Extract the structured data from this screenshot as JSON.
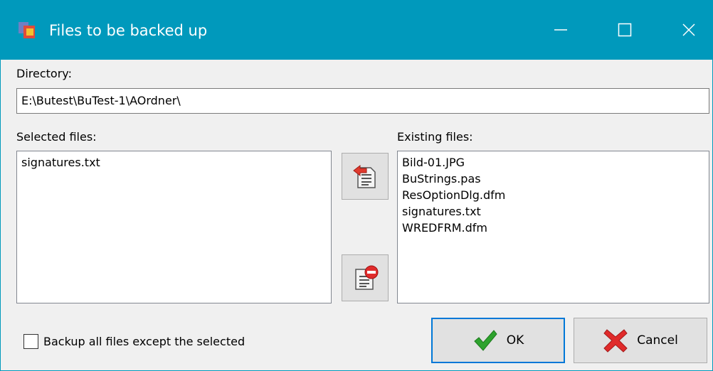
{
  "window": {
    "title": "Files to be backed up"
  },
  "directory": {
    "label": "Directory:",
    "value": "E:\\Butest\\BuTest-1\\AOrdner\\"
  },
  "selected": {
    "label": "Selected files:",
    "items": [
      "signatures.txt"
    ]
  },
  "existing": {
    "label": "Existing files:",
    "items": [
      "Bild-01.JPG",
      "BuStrings.pas",
      "ResOptionDlg.dfm",
      "signatures.txt",
      "WREDFRM.dfm"
    ]
  },
  "options": {
    "backup_except_label": "Backup all files except the selected",
    "backup_except_checked": false
  },
  "buttons": {
    "ok_label": "OK",
    "cancel_label": "Cancel"
  },
  "colors": {
    "titlebar": "#0099bc",
    "ok_focus": "#0078d7",
    "check_green": "#2ea32e",
    "cancel_red": "#e02b2b"
  },
  "icons": {
    "app": "app-icon",
    "add": "add-file-icon",
    "remove": "remove-file-icon",
    "ok": "checkmark-icon",
    "cancel": "x-icon"
  }
}
